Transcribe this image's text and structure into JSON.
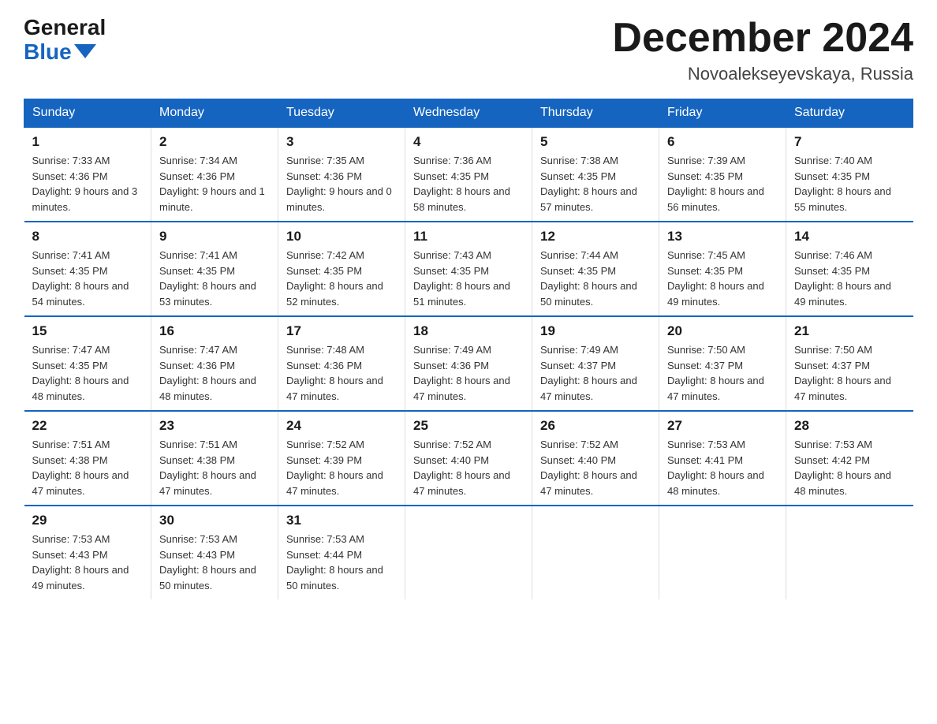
{
  "header": {
    "logo_general": "General",
    "logo_blue": "Blue",
    "month_title": "December 2024",
    "location": "Novoalekseyevskaya, Russia"
  },
  "weekdays": [
    "Sunday",
    "Monday",
    "Tuesday",
    "Wednesday",
    "Thursday",
    "Friday",
    "Saturday"
  ],
  "weeks": [
    [
      {
        "day": "1",
        "sunrise": "7:33 AM",
        "sunset": "4:36 PM",
        "daylight": "9 hours and 3 minutes."
      },
      {
        "day": "2",
        "sunrise": "7:34 AM",
        "sunset": "4:36 PM",
        "daylight": "9 hours and 1 minute."
      },
      {
        "day": "3",
        "sunrise": "7:35 AM",
        "sunset": "4:36 PM",
        "daylight": "9 hours and 0 minutes."
      },
      {
        "day": "4",
        "sunrise": "7:36 AM",
        "sunset": "4:35 PM",
        "daylight": "8 hours and 58 minutes."
      },
      {
        "day": "5",
        "sunrise": "7:38 AM",
        "sunset": "4:35 PM",
        "daylight": "8 hours and 57 minutes."
      },
      {
        "day": "6",
        "sunrise": "7:39 AM",
        "sunset": "4:35 PM",
        "daylight": "8 hours and 56 minutes."
      },
      {
        "day": "7",
        "sunrise": "7:40 AM",
        "sunset": "4:35 PM",
        "daylight": "8 hours and 55 minutes."
      }
    ],
    [
      {
        "day": "8",
        "sunrise": "7:41 AM",
        "sunset": "4:35 PM",
        "daylight": "8 hours and 54 minutes."
      },
      {
        "day": "9",
        "sunrise": "7:41 AM",
        "sunset": "4:35 PM",
        "daylight": "8 hours and 53 minutes."
      },
      {
        "day": "10",
        "sunrise": "7:42 AM",
        "sunset": "4:35 PM",
        "daylight": "8 hours and 52 minutes."
      },
      {
        "day": "11",
        "sunrise": "7:43 AM",
        "sunset": "4:35 PM",
        "daylight": "8 hours and 51 minutes."
      },
      {
        "day": "12",
        "sunrise": "7:44 AM",
        "sunset": "4:35 PM",
        "daylight": "8 hours and 50 minutes."
      },
      {
        "day": "13",
        "sunrise": "7:45 AM",
        "sunset": "4:35 PM",
        "daylight": "8 hours and 49 minutes."
      },
      {
        "day": "14",
        "sunrise": "7:46 AM",
        "sunset": "4:35 PM",
        "daylight": "8 hours and 49 minutes."
      }
    ],
    [
      {
        "day": "15",
        "sunrise": "7:47 AM",
        "sunset": "4:35 PM",
        "daylight": "8 hours and 48 minutes."
      },
      {
        "day": "16",
        "sunrise": "7:47 AM",
        "sunset": "4:36 PM",
        "daylight": "8 hours and 48 minutes."
      },
      {
        "day": "17",
        "sunrise": "7:48 AM",
        "sunset": "4:36 PM",
        "daylight": "8 hours and 47 minutes."
      },
      {
        "day": "18",
        "sunrise": "7:49 AM",
        "sunset": "4:36 PM",
        "daylight": "8 hours and 47 minutes."
      },
      {
        "day": "19",
        "sunrise": "7:49 AM",
        "sunset": "4:37 PM",
        "daylight": "8 hours and 47 minutes."
      },
      {
        "day": "20",
        "sunrise": "7:50 AM",
        "sunset": "4:37 PM",
        "daylight": "8 hours and 47 minutes."
      },
      {
        "day": "21",
        "sunrise": "7:50 AM",
        "sunset": "4:37 PM",
        "daylight": "8 hours and 47 minutes."
      }
    ],
    [
      {
        "day": "22",
        "sunrise": "7:51 AM",
        "sunset": "4:38 PM",
        "daylight": "8 hours and 47 minutes."
      },
      {
        "day": "23",
        "sunrise": "7:51 AM",
        "sunset": "4:38 PM",
        "daylight": "8 hours and 47 minutes."
      },
      {
        "day": "24",
        "sunrise": "7:52 AM",
        "sunset": "4:39 PM",
        "daylight": "8 hours and 47 minutes."
      },
      {
        "day": "25",
        "sunrise": "7:52 AM",
        "sunset": "4:40 PM",
        "daylight": "8 hours and 47 minutes."
      },
      {
        "day": "26",
        "sunrise": "7:52 AM",
        "sunset": "4:40 PM",
        "daylight": "8 hours and 47 minutes."
      },
      {
        "day": "27",
        "sunrise": "7:53 AM",
        "sunset": "4:41 PM",
        "daylight": "8 hours and 48 minutes."
      },
      {
        "day": "28",
        "sunrise": "7:53 AM",
        "sunset": "4:42 PM",
        "daylight": "8 hours and 48 minutes."
      }
    ],
    [
      {
        "day": "29",
        "sunrise": "7:53 AM",
        "sunset": "4:43 PM",
        "daylight": "8 hours and 49 minutes."
      },
      {
        "day": "30",
        "sunrise": "7:53 AM",
        "sunset": "4:43 PM",
        "daylight": "8 hours and 50 minutes."
      },
      {
        "day": "31",
        "sunrise": "7:53 AM",
        "sunset": "4:44 PM",
        "daylight": "8 hours and 50 minutes."
      },
      null,
      null,
      null,
      null
    ]
  ]
}
